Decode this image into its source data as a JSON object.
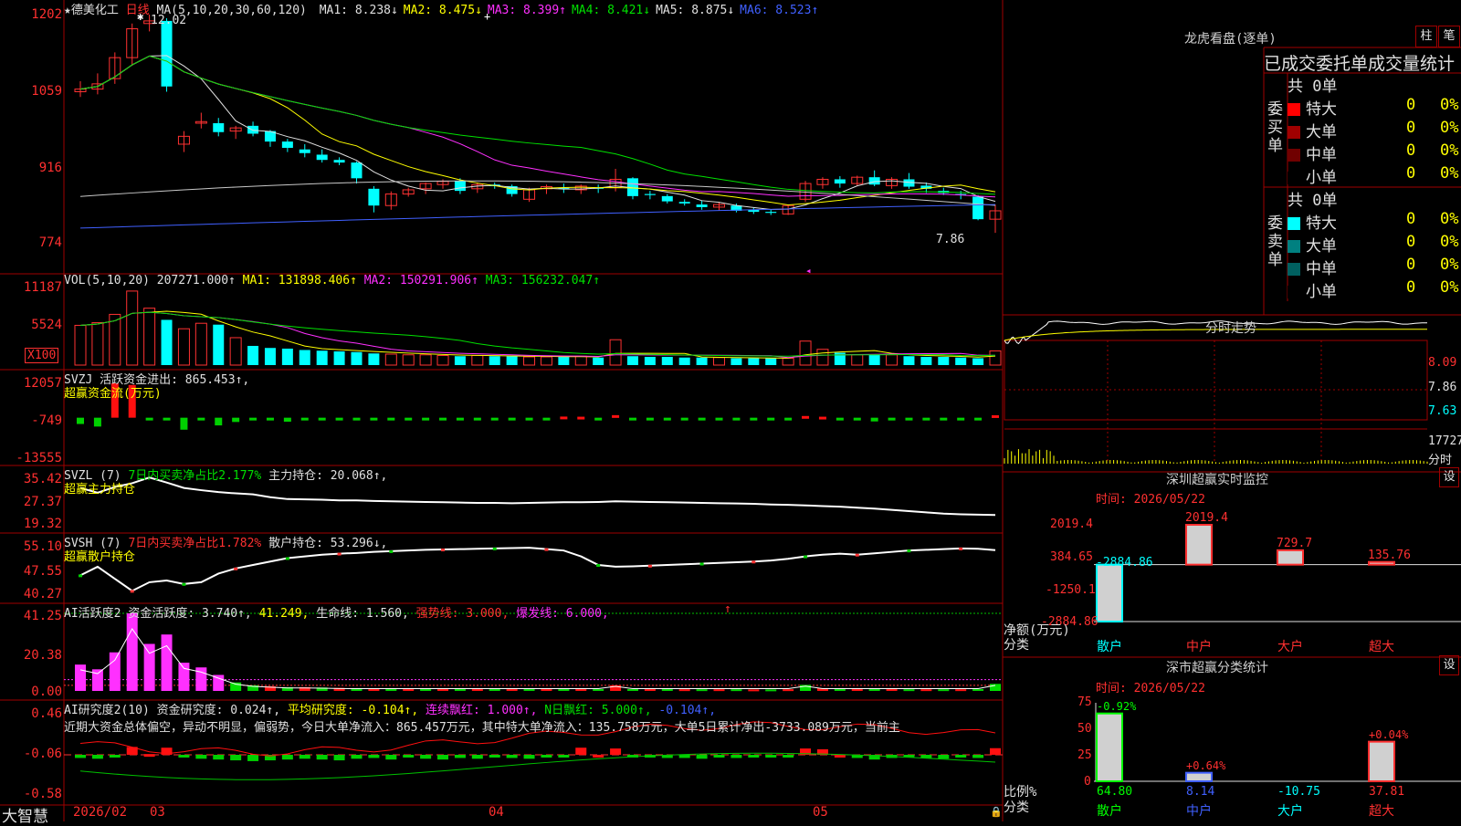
{
  "stock": {
    "title": "★德美化工",
    "period": "日线"
  },
  "price_pane": {
    "ma_legend": "MA(5,10,20,30,60,120)",
    "ma_values": [
      {
        "label": "MA1: 8.238↓",
        "color": "#e0e0e0"
      },
      {
        "label": "MA2: 8.475↓",
        "color": "#ffff00"
      },
      {
        "label": "MA3: 8.399↑",
        "color": "#ff30ff"
      },
      {
        "label": "MA4: 8.421↓",
        "color": "#00e000"
      },
      {
        "label": "MA5: 8.875↓",
        "color": "#e0e0e0"
      },
      {
        "label": "MA6: 8.523↑",
        "color": "#4060ff"
      }
    ],
    "y_labels": [
      "1202",
      "1059",
      "916",
      "774"
    ],
    "high_marker": "12.02",
    "low_marker": "7.86"
  },
  "vol_pane": {
    "legend": "VOL(5,10,20)",
    "value": "207271.000↑",
    "ma1": "MA1: 131898.406↑",
    "ma2": "MA2: 150291.906↑",
    "ma3": "MA3: 156232.047↑",
    "y_labels": [
      "11187",
      "5524"
    ],
    "unit": "X100"
  },
  "svzj_pane": {
    "legend": "SVZJ",
    "label": "活跃资金进出: 865.453↑,",
    "subtitle": "超赢资金流(万元)",
    "y_labels": [
      "12057",
      "-749",
      "-13555"
    ]
  },
  "svzl_pane": {
    "legend": "SVZL (7)",
    "label1": "7日内买卖净占比2.177%",
    "label2": "主力持仓: 20.068↑,",
    "subtitle": "超赢主力持仓",
    "y_labels": [
      "35.42",
      "27.37",
      "19.32"
    ]
  },
  "svsh_pane": {
    "legend": "SVSH (7)",
    "label1": "7日内买卖净占比1.782%",
    "label2": "散户持仓: 53.296↓,",
    "subtitle": "超赢散户持仓",
    "y_labels": [
      "55.10",
      "47.55",
      "40.27"
    ]
  },
  "ai_active_pane": {
    "legend": "AI活跃度2",
    "label1": "资金活跃度: 3.740↑,",
    "label2": "41.249,",
    "label3": "生命线: 1.560,",
    "label4": "强势线: 3.000,",
    "label5": "爆发线: 6.000,",
    "arrow": "↑",
    "y_labels": [
      "41.25",
      "20.38",
      "0.00"
    ]
  },
  "ai_research_pane": {
    "legend": "AI研究度2(10)",
    "label1": "资金研究度: 0.024↑,",
    "label2": "平均研究度: -0.104↑,",
    "label3": "连续飘红: 1.000↑,",
    "label4": "N日飘红: 5.000↑,",
    "label5": "-0.104↑,",
    "commentary": "近期大资金总体偏空，异动不明显，偏弱势，今日大单净流入：865.457万元，其中特大单净流入：135.758万元，大单5日累计净出-3733.089万元，当前主",
    "y_labels": [
      "0.46",
      "-0.06",
      "-0.58"
    ]
  },
  "x_axis": {
    "labels": [
      "2026/02",
      "03",
      "04",
      "05"
    ],
    "brand": "大智慧"
  },
  "order_book": {
    "title": "龙虎看盘(逐单)",
    "btn1": "柱",
    "btn2": "笔",
    "header": "已成交委托单成交量统计",
    "buy": {
      "side_label": "委买单",
      "total": "共 0单",
      "rows": [
        {
          "name": "特大",
          "value": "0",
          "pct": "0%",
          "color": "#ff0000"
        },
        {
          "name": "大单",
          "value": "0",
          "pct": "0%",
          "color": "#a00000"
        },
        {
          "name": "中单",
          "value": "0",
          "pct": "0%",
          "color": "#700000"
        },
        {
          "name": "小单",
          "value": "0",
          "pct": "0%",
          "color": "#000000"
        }
      ]
    },
    "sell": {
      "side_label": "委卖单",
      "total": "共 0单",
      "rows": [
        {
          "name": "特大",
          "value": "0",
          "pct": "0%",
          "color": "#00ffff"
        },
        {
          "name": "大单",
          "value": "0",
          "pct": "0%",
          "color": "#008080"
        },
        {
          "name": "中单",
          "value": "0",
          "pct": "0%",
          "color": "#006060"
        },
        {
          "name": "小单",
          "value": "0",
          "pct": "0%",
          "color": "#000000"
        }
      ]
    }
  },
  "intraday": {
    "title": "分时走势",
    "y_labels": [
      "8.09",
      "7.86",
      "7.63"
    ],
    "vol_label": "17727",
    "corner": "分时"
  },
  "sz_monitor": {
    "title": "深圳超赢实时监控",
    "settings": "设",
    "time": "时间: 2026/05/22",
    "y_labels": [
      "2019.4",
      "384.65",
      "-1250.1",
      "-2884.86"
    ],
    "ylabel1": "净额(万元)",
    "ylabel2": "分类",
    "categories": [
      "散户",
      "中户",
      "大户",
      "超大"
    ],
    "values": [
      -2884.86,
      2019.4,
      729.7,
      135.76
    ],
    "value_labels": [
      "-2884.86",
      "2019.4",
      "729.7",
      "135.76"
    ]
  },
  "sz_classify": {
    "title": "深市超赢分类统计",
    "settings": "设",
    "time": "时间: 2026/05/22",
    "y_labels": [
      "75",
      "50",
      "25",
      "0"
    ],
    "ylabel1": "比例%",
    "ylabel2": "分类",
    "categories": [
      "散户",
      "中户",
      "大户",
      "超大"
    ],
    "values": [
      64.8,
      8.14,
      -10.75,
      37.81
    ],
    "value_labels": [
      "64.80",
      "8.14",
      "-10.75",
      "37.81"
    ],
    "change_labels": [
      "-0.92%",
      "+0.64%",
      "",
      "+0.04%"
    ]
  },
  "chart_data": [
    {
      "type": "candlestick",
      "title": "德美化工 日线",
      "ylim": [
        7.74,
        12.02
      ],
      "ohlc": [
        [
          10.55,
          10.75,
          10.45,
          10.6
        ],
        [
          10.6,
          10.9,
          10.5,
          10.7
        ],
        [
          10.8,
          11.3,
          10.7,
          11.2
        ],
        [
          11.2,
          11.85,
          11.05,
          11.75
        ],
        [
          11.85,
          12.02,
          11.7,
          11.9
        ],
        [
          11.9,
          11.95,
          10.55,
          10.65
        ],
        [
          9.55,
          9.8,
          9.4,
          9.7
        ],
        [
          9.95,
          10.15,
          9.85,
          9.98
        ],
        [
          9.95,
          10.05,
          9.7,
          9.78
        ],
        [
          9.8,
          9.9,
          9.65,
          9.86
        ],
        [
          9.9,
          9.98,
          9.7,
          9.75
        ],
        [
          9.8,
          9.82,
          9.5,
          9.6
        ],
        [
          9.6,
          9.65,
          9.4,
          9.48
        ],
        [
          9.45,
          9.55,
          9.3,
          9.38
        ],
        [
          9.35,
          9.45,
          9.2,
          9.25
        ],
        [
          9.25,
          9.3,
          9.15,
          9.2
        ],
        [
          9.2,
          9.22,
          8.8,
          8.9
        ],
        [
          8.7,
          8.75,
          8.25,
          8.38
        ],
        [
          8.38,
          8.65,
          8.3,
          8.6
        ],
        [
          8.6,
          8.72,
          8.55,
          8.68
        ],
        [
          8.7,
          8.82,
          8.6,
          8.8
        ],
        [
          8.78,
          8.88,
          8.7,
          8.84
        ],
        [
          8.85,
          8.9,
          8.6,
          8.66
        ],
        [
          8.7,
          8.82,
          8.62,
          8.78
        ],
        [
          8.78,
          8.82,
          8.7,
          8.75
        ],
        [
          8.75,
          8.78,
          8.55,
          8.6
        ],
        [
          8.5,
          8.72,
          8.45,
          8.68
        ],
        [
          8.7,
          8.78,
          8.6,
          8.74
        ],
        [
          8.72,
          8.8,
          8.62,
          8.7
        ],
        [
          8.68,
          8.78,
          8.6,
          8.75
        ],
        [
          8.72,
          8.78,
          8.62,
          8.7
        ],
        [
          8.72,
          9.08,
          8.65,
          8.88
        ],
        [
          8.9,
          8.92,
          8.5,
          8.56
        ],
        [
          8.6,
          8.66,
          8.5,
          8.58
        ],
        [
          8.56,
          8.6,
          8.42,
          8.46
        ],
        [
          8.45,
          8.5,
          8.38,
          8.42
        ],
        [
          8.4,
          8.48,
          8.3,
          8.35
        ],
        [
          8.35,
          8.45,
          8.28,
          8.4
        ],
        [
          8.38,
          8.42,
          8.25,
          8.28
        ],
        [
          8.3,
          8.34,
          8.22,
          8.26
        ],
        [
          8.26,
          8.3,
          8.2,
          8.24
        ],
        [
          8.22,
          8.4,
          8.2,
          8.38
        ],
        [
          8.5,
          8.85,
          8.45,
          8.8
        ],
        [
          8.78,
          8.92,
          8.7,
          8.88
        ],
        [
          8.88,
          8.94,
          8.72,
          8.8
        ],
        [
          8.8,
          8.95,
          8.76,
          8.92
        ],
        [
          8.92,
          9.05,
          8.75,
          8.78
        ],
        [
          8.76,
          8.92,
          8.7,
          8.88
        ],
        [
          8.88,
          9.0,
          8.7,
          8.74
        ],
        [
          8.76,
          8.82,
          8.62,
          8.7
        ],
        [
          8.66,
          8.72,
          8.58,
          8.62
        ],
        [
          8.6,
          8.66,
          8.5,
          8.58
        ],
        [
          8.55,
          8.58,
          8.1,
          8.12
        ],
        [
          8.12,
          8.4,
          7.86,
          8.28
        ]
      ]
    },
    {
      "type": "bar",
      "title": "VOL(5,10,20)",
      "unit": "X100",
      "ylim": [
        0,
        11187
      ],
      "values": [
        5800,
        6200,
        7400,
        10800,
        8300,
        6600,
        5300,
        6100,
        5900,
        4000,
        2800,
        2500,
        2400,
        2200,
        2100,
        2000,
        1900,
        1700,
        1600,
        1500,
        1500,
        1400,
        1300,
        1400,
        1300,
        1300,
        1200,
        1200,
        1200,
        1300,
        1100,
        3700,
        1300,
        1200,
        1200,
        1100,
        1100,
        1100,
        1000,
        1000,
        1000,
        1000,
        3500,
        2300,
        1800,
        1500,
        1500,
        1500,
        1300,
        1200,
        1200,
        1100,
        1000,
        2070
      ]
    },
    {
      "type": "bar",
      "title": "活跃资金进出",
      "ylim": [
        -13555,
        12057
      ],
      "values": [
        -2200,
        -3100,
        12057,
        11500,
        -100,
        -300,
        -4200,
        -900,
        -2700,
        -1500,
        -200,
        -100,
        -1400,
        -150,
        -700,
        -120,
        -700,
        -200,
        -300,
        -800,
        -100,
        -250,
        -180,
        -160,
        -600,
        -150,
        -140,
        -130,
        400,
        350,
        -100,
        900,
        -120,
        -200,
        -150,
        -130,
        -110,
        -100,
        -90,
        -100,
        -180,
        -150,
        600,
        350,
        -200,
        -800,
        -1300,
        -200,
        -600,
        -100,
        -150,
        -100,
        -400,
        865
      ]
    },
    {
      "type": "line",
      "title": "超赢主力持仓",
      "ylim": [
        19.32,
        35.42
      ],
      "values": [
        31.5,
        30.0,
        31.8,
        33.0,
        34.8,
        33.2,
        31.5,
        30.8,
        30.2,
        29.8,
        29.5,
        28.6,
        28.0,
        27.9,
        27.8,
        27.6,
        27.6,
        27.4,
        27.3,
        27.2,
        27.1,
        27.0,
        26.9,
        26.8,
        26.8,
        26.7,
        26.8,
        26.9,
        27.0,
        27.0,
        27.1,
        27.3,
        27.2,
        27.1,
        27.0,
        26.9,
        26.8,
        26.7,
        26.6,
        26.5,
        26.3,
        26.2,
        26.0,
        25.8,
        25.6,
        25.3,
        25.0,
        24.6,
        24.2,
        23.8,
        23.4,
        23.2,
        23.1,
        23.0
      ]
    },
    {
      "type": "line",
      "title": "超赢散户持仓",
      "ylim": [
        40.27,
        55.1
      ],
      "values": [
        46.0,
        48.5,
        45.0,
        41.5,
        44.0,
        44.5,
        43.5,
        44.0,
        46.5,
        48.0,
        49.0,
        50.0,
        51.0,
        51.5,
        52.0,
        52.3,
        52.5,
        52.8,
        53.0,
        53.2,
        53.4,
        53.5,
        53.6,
        53.7,
        53.8,
        53.9,
        54.0,
        53.6,
        53.2,
        51.5,
        49.0,
        48.5,
        48.6,
        48.8,
        49.0,
        49.2,
        49.4,
        49.6,
        49.8,
        50.0,
        50.3,
        50.8,
        51.5,
        52.0,
        52.3,
        52.0,
        52.4,
        52.8,
        53.2,
        53.4,
        53.6,
        53.8,
        53.7,
        53.3
      ]
    },
    {
      "type": "bar",
      "title": "AI活跃度2",
      "ylim": [
        0,
        41.25
      ],
      "values": [
        14.0,
        11.5,
        20.5,
        41.25,
        25.0,
        30.0,
        15.0,
        12.5,
        8.5,
        4.5,
        3.0,
        2.5,
        2.0,
        2.0,
        1.8,
        1.6,
        1.5,
        1.4,
        1.3,
        1.2,
        1.2,
        1.2,
        1.1,
        1.0,
        1.0,
        1.0,
        1.0,
        1.0,
        1.2,
        1.0,
        1.0,
        3.0,
        1.0,
        1.0,
        1.0,
        0.9,
        0.9,
        0.9,
        0.9,
        0.8,
        0.8,
        0.9,
        3.2,
        1.5,
        1.2,
        1.0,
        1.0,
        1.0,
        0.9,
        0.9,
        0.9,
        0.9,
        1.0,
        3.74
      ]
    },
    {
      "type": "bar",
      "title": "AI研究度2(10)",
      "ylim": [
        -0.58,
        0.46
      ],
      "values": [
        -0.1,
        -0.11,
        -0.08,
        0.04,
        -0.05,
        0.03,
        -0.08,
        -0.11,
        -0.12,
        -0.13,
        -0.14,
        -0.13,
        -0.12,
        -0.11,
        -0.12,
        -0.13,
        -0.11,
        -0.1,
        -0.12,
        -0.09,
        -0.11,
        -0.12,
        -0.1,
        -0.11,
        -0.09,
        -0.1,
        -0.11,
        -0.09,
        -0.08,
        0.03,
        -0.06,
        0.02,
        -0.08,
        -0.09,
        -0.1,
        -0.1,
        -0.11,
        -0.09,
        -0.1,
        -0.08,
        -0.09,
        -0.08,
        0.02,
        0.01,
        -0.06,
        -0.1,
        -0.12,
        -0.1,
        -0.09,
        -0.1,
        -0.11,
        -0.09,
        -0.1,
        0.024
      ]
    },
    {
      "type": "bar",
      "title": "深圳超赢实时监控",
      "categories": [
        "散户",
        "中户",
        "大户",
        "超大"
      ],
      "values": [
        -2884.86,
        2019.4,
        729.7,
        135.76
      ],
      "ylim": [
        -2884.86,
        2019.4
      ],
      "ylabel": "净额(万元)"
    },
    {
      "type": "bar",
      "title": "深市超赢分类统计",
      "categories": [
        "散户",
        "中户",
        "大户",
        "超大"
      ],
      "values": [
        64.8,
        8.14,
        -10.75,
        37.81
      ],
      "ylim": [
        0,
        75
      ],
      "ylabel": "比例%"
    }
  ]
}
